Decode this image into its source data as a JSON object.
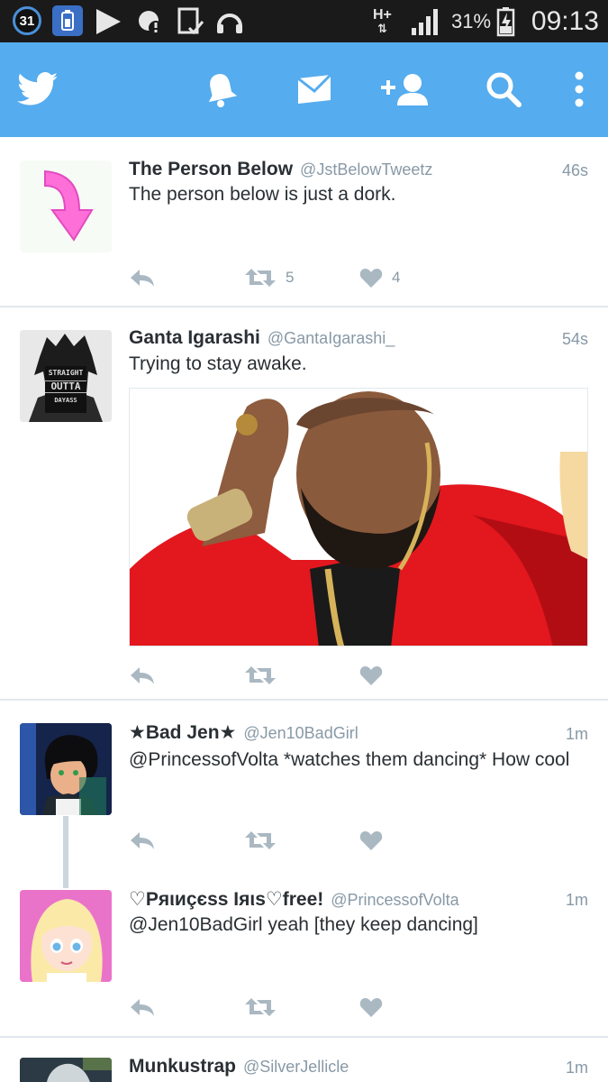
{
  "status_bar": {
    "calendar_day": "31",
    "network": "H+",
    "battery_percent": "31%",
    "time": "09:13"
  },
  "nav": {
    "icons": [
      "twitter-bird-icon",
      "bell-icon",
      "envelope-icon",
      "add-user-icon",
      "search-icon",
      "overflow-menu-icon"
    ]
  },
  "colors": {
    "brand": "#55acee",
    "status_bar": "#1a1a1a",
    "meta_text": "#8899a6"
  },
  "tweets": [
    {
      "name": "The Person Below",
      "handle": "@JstBelowTweetz",
      "time": "46s",
      "text": "The person below is just a dork.",
      "retweets": "5",
      "likes": "4"
    },
    {
      "name": "Ganta Igarashi",
      "handle": "@GantaIgarashi_",
      "time": "54s",
      "text": "Trying to stay awake.",
      "avatar_text": [
        "STRAIGHT",
        "OUTTA",
        "DAYASS"
      ]
    },
    {
      "name": "★Bad Jen★",
      "handle": "@Jen10BadGirl",
      "time": "1m",
      "text": "@PrincessofVolta *watches them dancing* How cool"
    },
    {
      "name": "♡Pяιиçєѕѕ Iяιѕ♡free!",
      "handle": "@PrincessofVolta",
      "time": "1m",
      "text": "@Jen10BadGirl yeah [they keep dancing]"
    },
    {
      "name": "Munkustrap",
      "handle": "@SilverJellicle",
      "time": "1m"
    }
  ]
}
